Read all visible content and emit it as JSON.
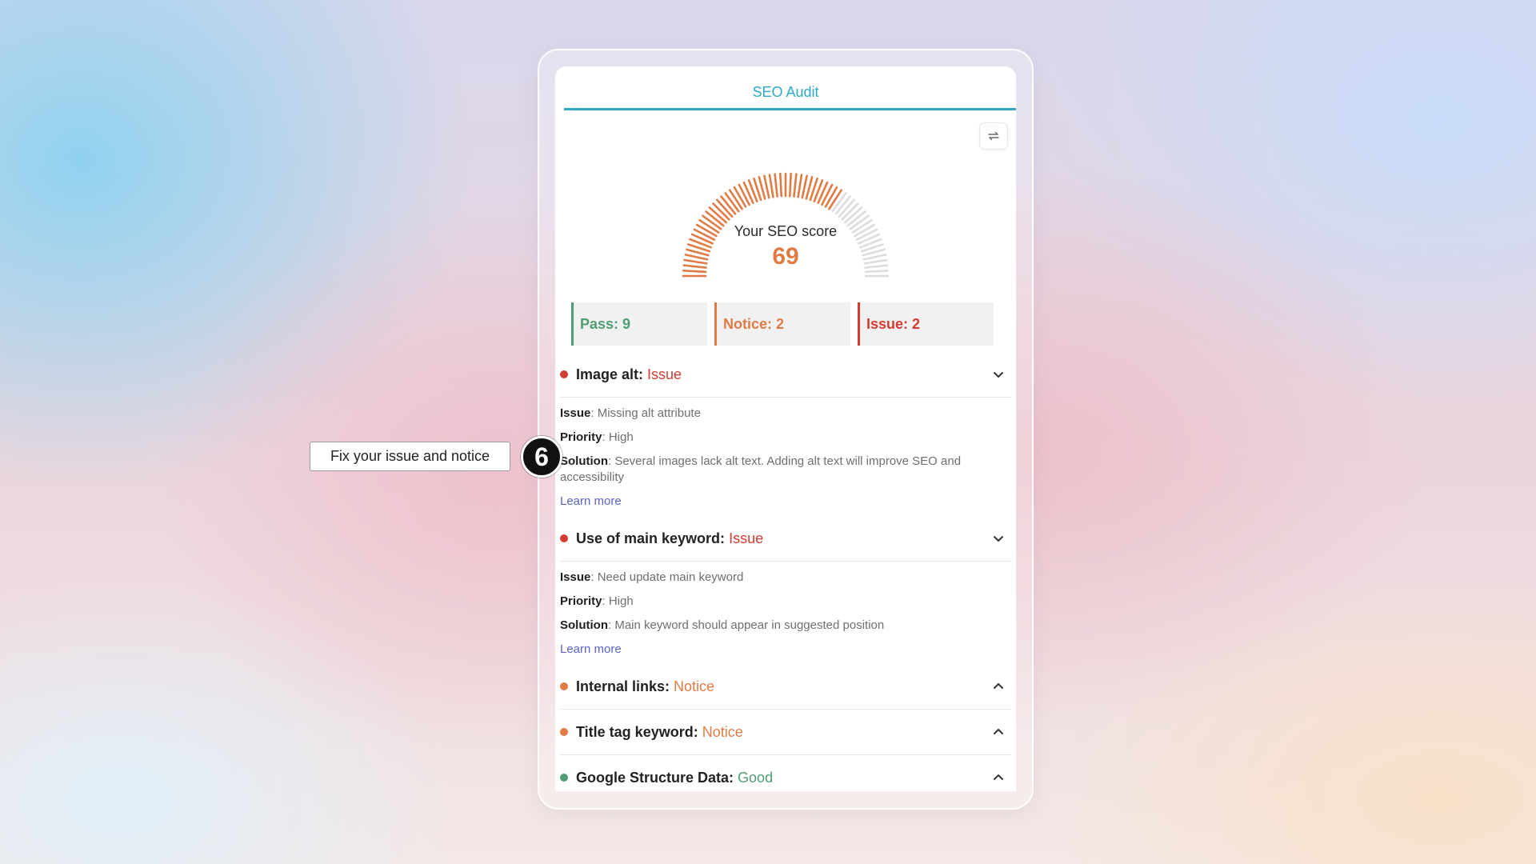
{
  "tab": {
    "label": "SEO Audit"
  },
  "icons": {
    "refresh": "refresh-icon",
    "expand": "chevron-down-icon",
    "collapse": "chevron-up-icon"
  },
  "colors": {
    "accent": "#2fa9c4",
    "pass": "#4f9e72",
    "notice": "#e07b45",
    "issue": "#d33c32",
    "link": "#5b62c9"
  },
  "score": {
    "caption": "Your SEO score",
    "value": "69",
    "max": 100
  },
  "stats": {
    "pass": "Pass: 9",
    "notice": "Notice: 2",
    "issue": "Issue: 2"
  },
  "audits": [
    {
      "title": "Image alt:",
      "status": "Issue",
      "issue_label": "Issue",
      "issue_value": ": Missing alt attribute",
      "priority_label": "Priority",
      "priority_value": ": High",
      "solution_label": "Solution",
      "solution_value": ": Several images lack alt text. Adding alt text will improve SEO and accessibility",
      "learn_more": "Learn more"
    },
    {
      "title": "Use of main keyword:",
      "status": "Issue",
      "issue_label": "Issue",
      "issue_value": ": Need update main keyword",
      "priority_label": "Priority",
      "priority_value": ": High",
      "solution_label": "Solution",
      "solution_value": ": Main keyword should appear in suggested position",
      "learn_more": "Learn more"
    },
    {
      "title": "Internal links:",
      "status": "Notice"
    },
    {
      "title": "Title tag keyword:",
      "status": "Notice"
    },
    {
      "title": "Google Structure Data:",
      "status": "Good"
    }
  ],
  "callout": {
    "text": "Fix your issue and notice",
    "step": "6"
  }
}
